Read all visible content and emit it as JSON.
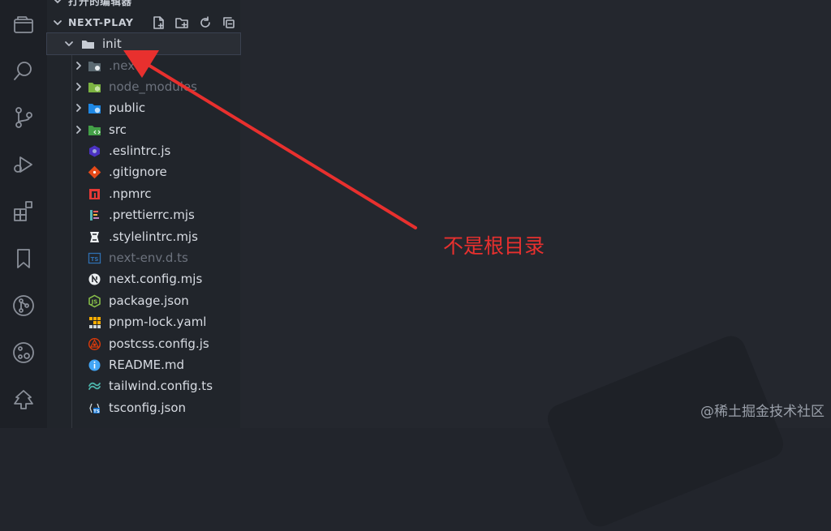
{
  "explorer": {
    "open_editors_label": "打开的编辑器",
    "project_label": "NEXT-PLAY",
    "toolbar": [
      "new-file-icon",
      "new-folder-icon",
      "refresh-icon",
      "collapse-all-icon"
    ]
  },
  "tree": {
    "root": "init",
    "items": [
      {
        "label": ".next",
        "kind": "folder",
        "icon": "next-folder-icon",
        "dim": true
      },
      {
        "label": "node_modules",
        "kind": "folder",
        "icon": "node-folder-icon",
        "dim": true
      },
      {
        "label": "public",
        "kind": "folder",
        "icon": "public-folder-icon",
        "dim": false
      },
      {
        "label": "src",
        "kind": "folder",
        "icon": "src-folder-icon",
        "dim": false
      },
      {
        "label": ".eslintrc.js",
        "kind": "file",
        "icon": "eslint-icon",
        "dim": false
      },
      {
        "label": ".gitignore",
        "kind": "file",
        "icon": "git-icon",
        "dim": false
      },
      {
        "label": ".npmrc",
        "kind": "file",
        "icon": "npm-icon",
        "dim": false
      },
      {
        "label": ".prettierrc.mjs",
        "kind": "file",
        "icon": "prettier-icon",
        "dim": false
      },
      {
        "label": ".stylelintrc.mjs",
        "kind": "file",
        "icon": "stylelint-icon",
        "dim": false
      },
      {
        "label": "next-env.d.ts",
        "kind": "file",
        "icon": "typescript-def-icon",
        "dim": true
      },
      {
        "label": "next.config.mjs",
        "kind": "file",
        "icon": "nextjs-icon",
        "dim": false
      },
      {
        "label": "package.json",
        "kind": "file",
        "icon": "nodejs-icon",
        "dim": false
      },
      {
        "label": "pnpm-lock.yaml",
        "kind": "file",
        "icon": "pnpm-icon",
        "dim": false
      },
      {
        "label": "postcss.config.js",
        "kind": "file",
        "icon": "postcss-icon",
        "dim": false
      },
      {
        "label": "README.md",
        "kind": "file",
        "icon": "info-icon",
        "dim": false
      },
      {
        "label": "tailwind.config.ts",
        "kind": "file",
        "icon": "tailwind-icon",
        "dim": false
      },
      {
        "label": "tsconfig.json",
        "kind": "file",
        "icon": "tsconfig-icon",
        "dim": false
      }
    ]
  },
  "annotation": {
    "text": "不是根目录",
    "color": "#e8302e"
  },
  "watermark": "@稀土掘金技术社区",
  "colors": {
    "background": "#22252c",
    "sidebar": "#21252b",
    "activity_bar": "#1d2026",
    "text": "#d8dce3",
    "dim_text": "#6c727d"
  }
}
